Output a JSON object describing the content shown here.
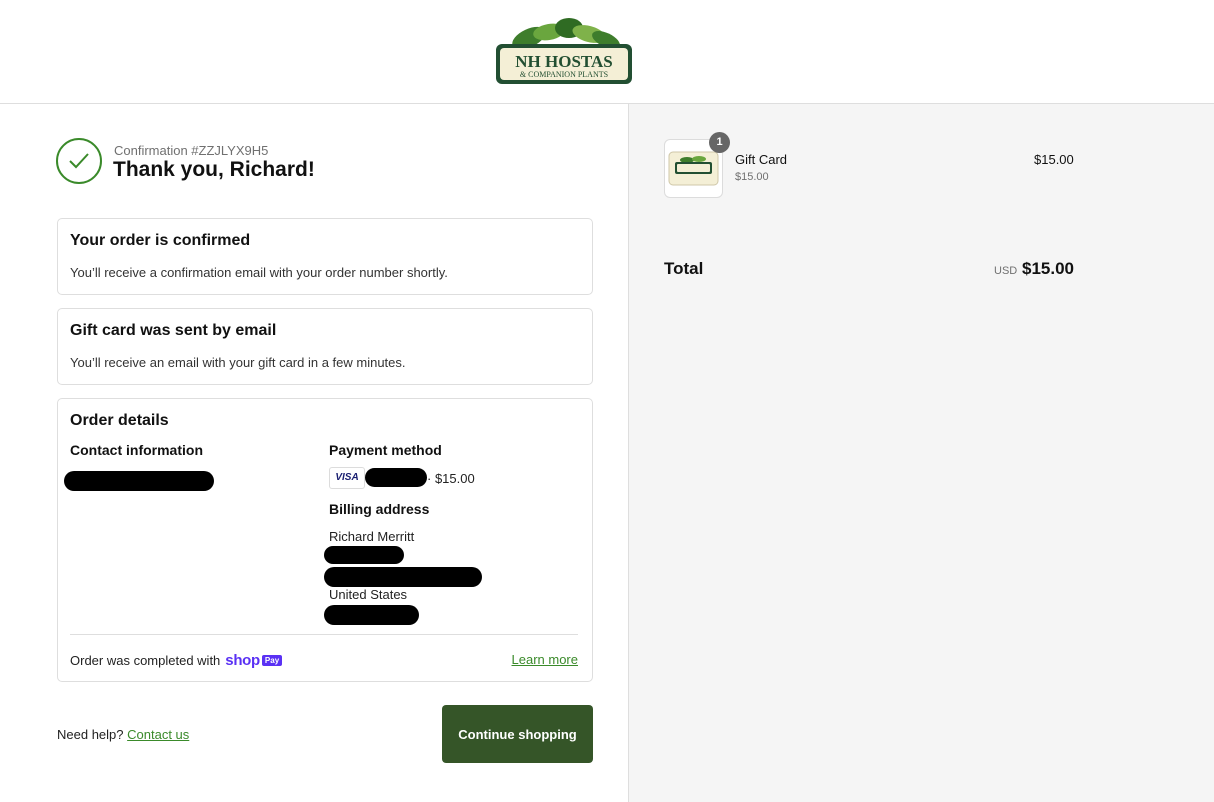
{
  "brand": {
    "logo_line1": "NH HOSTAS",
    "logo_line2": "& COMPANION PLANTS"
  },
  "confirmation": {
    "number": "Confirmation #ZZJLYX9H5",
    "thanks": "Thank you, Richard!"
  },
  "order_confirmed": {
    "title": "Your order is confirmed",
    "body": "You’ll receive a confirmation email with your order number shortly."
  },
  "gift_card_sent": {
    "title": "Gift card was sent by email",
    "body": "You’ll receive an email with your gift card in a few minutes."
  },
  "order_details": {
    "title": "Order details",
    "contact_label": "Contact information",
    "payment_label": "Payment method",
    "card_brand": "VISA",
    "payment_amount": "· $15.00",
    "billing_label": "Billing address",
    "billing_name": "Richard Merritt",
    "billing_country": "United States",
    "completed_text": "Order was completed with",
    "shop_word": "shop",
    "pay_badge": "Pay",
    "learn_more": "Learn more"
  },
  "footer": {
    "need_help": "Need help?",
    "contact_us": "Contact us",
    "continue_label": "Continue shopping"
  },
  "summary": {
    "item": {
      "quantity": "1",
      "name": "Gift Card",
      "sub_price": "$15.00",
      "price": "$15.00"
    },
    "total_label": "Total",
    "currency": "USD",
    "total_value": "$15.00"
  },
  "colors": {
    "accent_green": "#3a8a2a",
    "button_green": "#355528",
    "shop_purple": "#5a31f4",
    "sidebar_bg": "#f5f5f5"
  }
}
